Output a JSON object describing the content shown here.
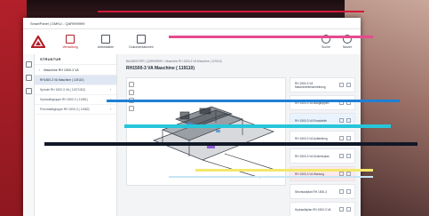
{
  "window": {
    "title": "SmartPanel | DMKU - QAR999999"
  },
  "toolbar": {
    "items": [
      {
        "label": "Verwaltung",
        "icon": "grid-icon"
      },
      {
        "label": "Artikeldaten",
        "icon": "document-icon"
      },
      {
        "label": "Dokumentationen",
        "icon": "folder-icon"
      }
    ],
    "right_items": [
      {
        "label": "Suche",
        "icon": "search-icon"
      },
      {
        "label": "Nutzer",
        "icon": "user-icon"
      }
    ]
  },
  "structure": {
    "heading": "STRUKTUR",
    "selected": "Maschine RH 1500-3 VA",
    "items": [
      {
        "label": "RH1500-3 VA Maschine ( 119110)",
        "active": true
      },
      {
        "label": "Spindel RH 1500-3 VA ( 11971002)",
        "active": false
      },
      {
        "label": "Hydraulikgruppe RH 1500-3 ( 11981)",
        "active": false
      },
      {
        "label": "Pneumatikgruppe RH 1500-3 ( 11982)",
        "active": false
      }
    ]
  },
  "main": {
    "breadcrumb": "BAUMEISTER | QAR999999 > Maschine RH 1500-3 VA Maschine ( 119110)",
    "title": "RH1500-3 VA Maschine ( 119110)"
  },
  "documents": [
    "RH 1500-3 VA Maschinenbeschreibung",
    "RH 1500-3 VA Baugruppen",
    "RH 1500-3 VA Ersatzteile",
    "RH 1500-3 VA Aufstellung",
    "RH 1500-3 VA Schmierplan",
    "RH 1500-3 VA Wartung",
    "Stromlaufplan RH 1500-3",
    "Hydraulikplan RH 1500-3 VA"
  ],
  "colors": {
    "brand": "#b2202a",
    "highlight": "#dfe7f3"
  }
}
